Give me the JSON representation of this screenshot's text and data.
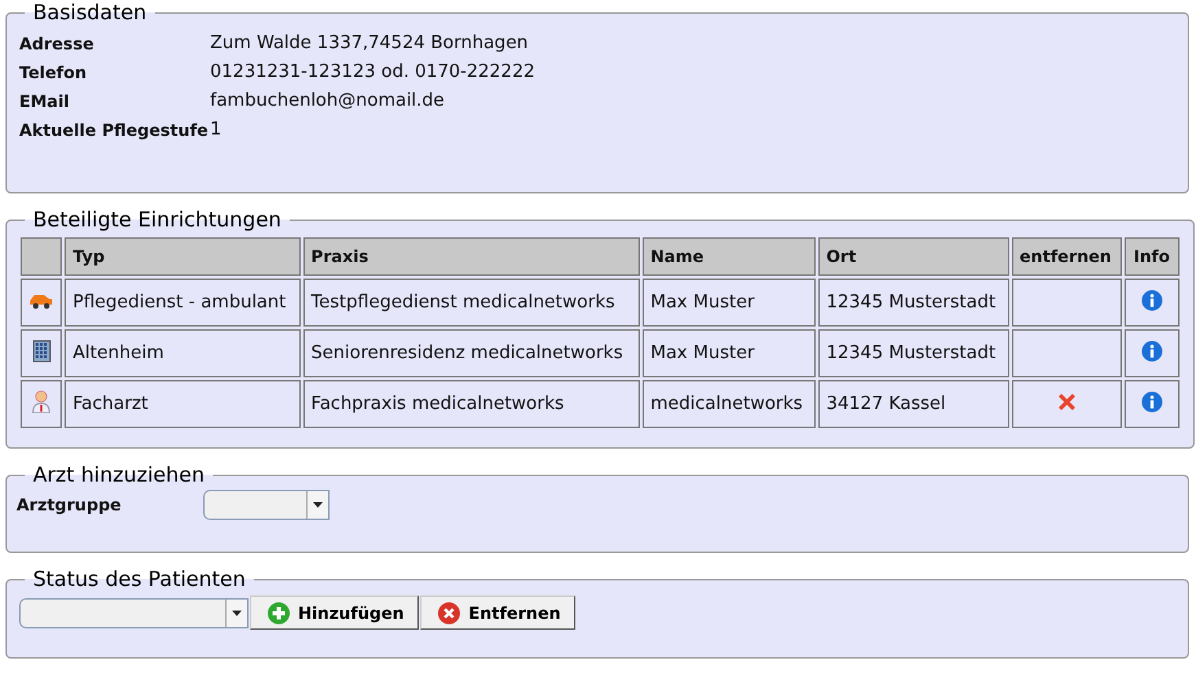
{
  "basisdaten": {
    "legend": "Basisdaten",
    "fields": [
      {
        "label": "Adresse",
        "value": "Zum Walde 1337,74524 Bornhagen"
      },
      {
        "label": "Telefon",
        "value": "01231231-123123 od. 0170-222222"
      },
      {
        "label": "EMail",
        "value": "fambuchenloh@nomail.de"
      },
      {
        "label": "Aktuelle Pflegestufe",
        "value": "1"
      }
    ]
  },
  "einrichtungen": {
    "legend": "Beteiligte Einrichtungen",
    "columns": [
      "Typ",
      "Praxis",
      "Name",
      "Ort",
      "entfernen",
      "Info"
    ],
    "rows": [
      {
        "kind": "car",
        "typ": "Pflegedienst - ambulant",
        "praxis": "Testpflegedienst medicalnetworks",
        "name": "Max Muster",
        "ort": "12345 Musterstadt",
        "removable": false
      },
      {
        "kind": "building",
        "typ": "Altenheim",
        "praxis": "Seniorenresidenz medicalnetworks",
        "name": "Max Muster",
        "ort": "12345 Musterstadt",
        "removable": false
      },
      {
        "kind": "doctor",
        "typ": "Facharzt",
        "praxis": "Fachpraxis medicalnetworks",
        "name": "medicalnetworks",
        "ort": "34127 Kassel",
        "removable": true
      }
    ]
  },
  "arzt": {
    "legend": "Arzt hinzuziehen",
    "label": "Arztgruppe"
  },
  "status": {
    "legend": "Status des Patienten",
    "buttons": [
      {
        "kind": "add",
        "label": "Hinzufügen"
      },
      {
        "kind": "remove",
        "label": "Entfernen"
      }
    ]
  }
}
